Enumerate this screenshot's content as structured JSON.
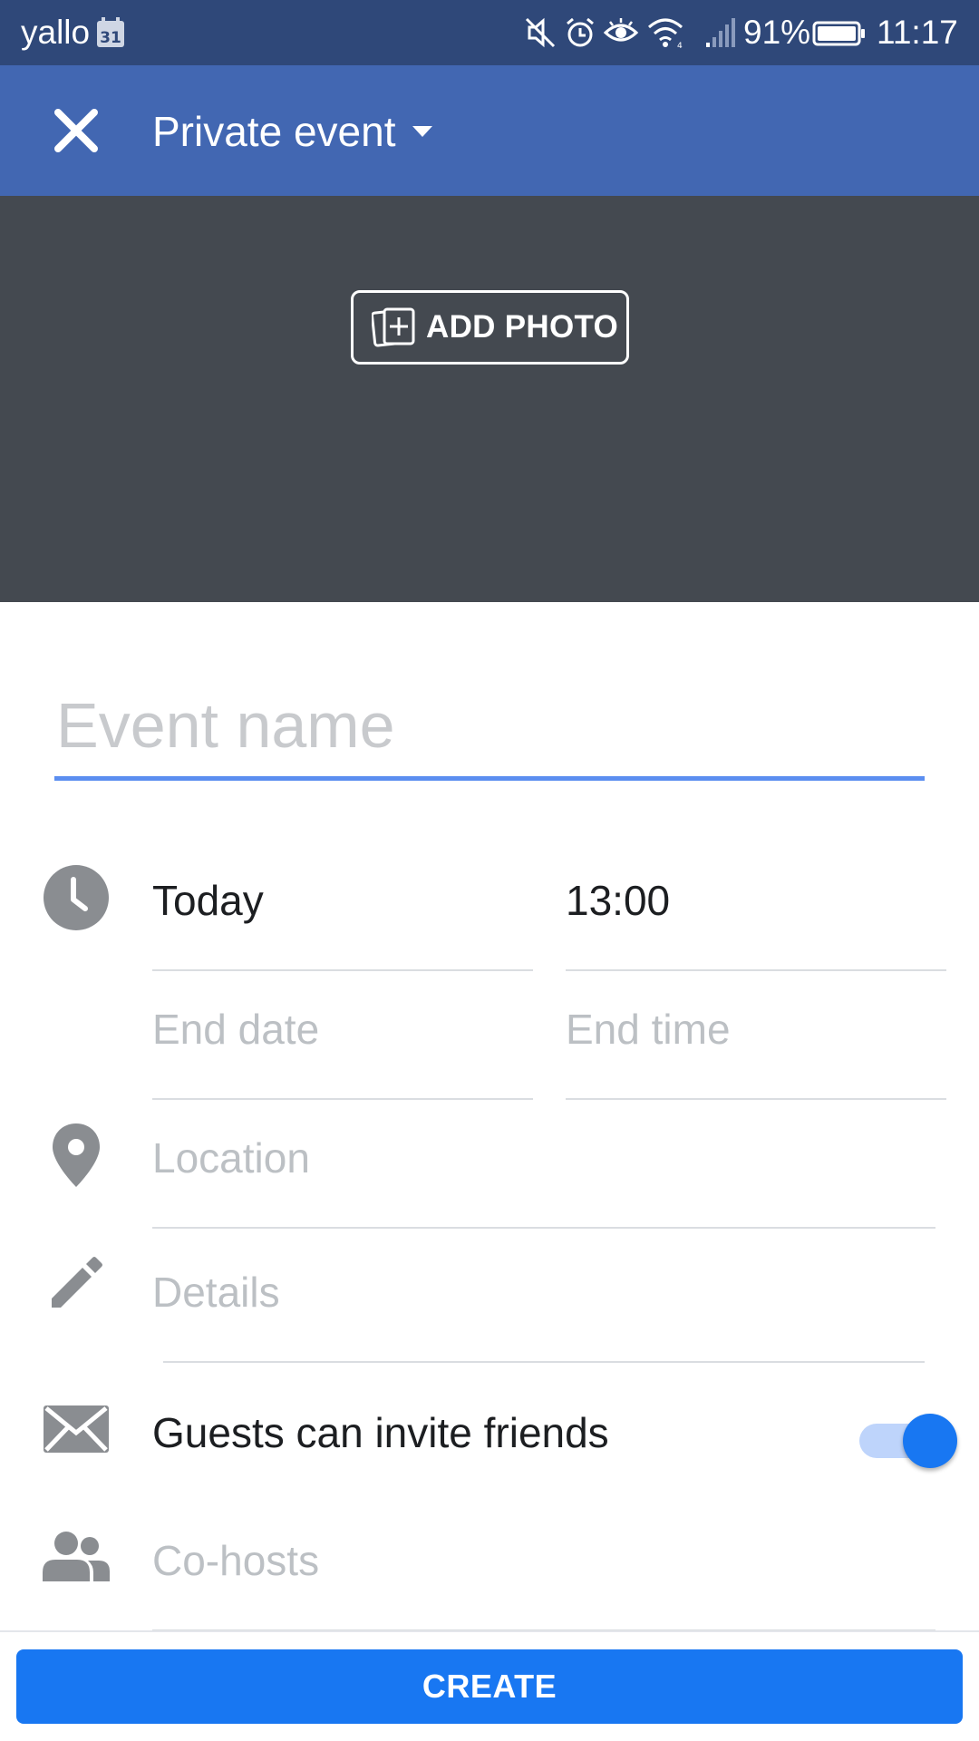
{
  "status_bar": {
    "carrier": "yallo",
    "calendar_date": "31",
    "battery": "91%",
    "time": "11:17",
    "icons": [
      "calendar-icon",
      "mute-icon",
      "alarm-icon",
      "eye-icon",
      "wifi-icon",
      "signal-icon",
      "battery-icon"
    ]
  },
  "header": {
    "close_icon": "close-icon",
    "privacy_label": "Private event",
    "privacy_dropdown_icon": "caret-down-icon"
  },
  "cover": {
    "add_photo_label": "ADD PHOTO",
    "add_photo_icon": "add-photo-icon"
  },
  "form": {
    "event_name": {
      "placeholder": "Event name",
      "value": ""
    },
    "start_date": {
      "value": "Today",
      "icon": "clock-icon"
    },
    "start_time": {
      "value": "13:00"
    },
    "end_date": {
      "placeholder": "End date"
    },
    "end_time": {
      "placeholder": "End time"
    },
    "location": {
      "placeholder": "Location",
      "icon": "location-pin-icon"
    },
    "details": {
      "placeholder": "Details",
      "icon": "pencil-icon"
    },
    "guests_invite": {
      "label": "Guests can invite friends",
      "enabled": true,
      "icon": "envelope-icon"
    },
    "cohosts": {
      "placeholder": "Co-hosts",
      "icon": "people-icon"
    }
  },
  "footer": {
    "create_label": "CREATE"
  },
  "colors": {
    "status_bar": "#2f4879",
    "app_bar": "#4267b2",
    "cover": "#444950",
    "accent": "#1877f2",
    "icon_gray": "#8a8d91"
  }
}
